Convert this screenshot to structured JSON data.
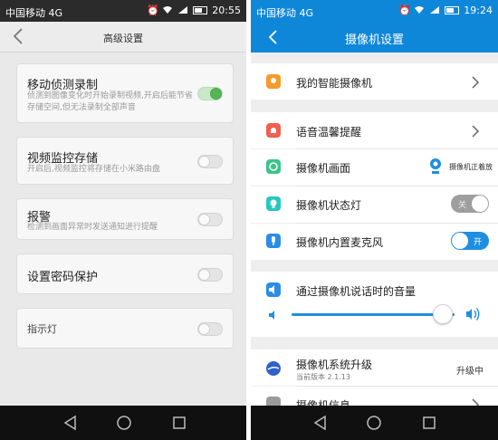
{
  "left": {
    "status": {
      "carrier": "中国移动 4G",
      "time": "20:55"
    },
    "header": {
      "title": "高级设置"
    },
    "settings": [
      {
        "title": "移动侦测录制",
        "desc": "侦测到图像变化时开始录制视频,开启后能节省存储空间,但无法录制全部声音",
        "enabled": true
      },
      {
        "title": "视频监控存储",
        "desc": "开启后,视频监控将存储在小米路由盘",
        "enabled": false
      },
      {
        "title": "报警",
        "desc": "检测到画面异常时发送通知进行提醒",
        "enabled": false
      },
      {
        "title": "设置密码保护",
        "desc": "",
        "enabled": false
      },
      {
        "title": "指示灯",
        "desc": "",
        "enabled": false
      }
    ]
  },
  "right": {
    "status": {
      "carrier": "中国移动 4G",
      "time": "19:24"
    },
    "header": {
      "title": "摄像机设置"
    },
    "rows": {
      "my_camera": {
        "label": "我的智能摄像机"
      },
      "voice_tips": {
        "label": "语音温馨提醒"
      },
      "camera_view": {
        "label": "摄像机画面",
        "status": "摄像机正着放"
      },
      "status_light": {
        "label": "摄像机状态灯",
        "toggle": "关"
      },
      "mic": {
        "label": "摄像机内置麦克风",
        "toggle": "开"
      },
      "volume": {
        "label": "通过摄像机说话时的音量",
        "level": 0.93
      },
      "upgrade": {
        "label": "摄像机系统升级",
        "sub": "当前版本 2.1.13",
        "status": "升级中"
      },
      "info": {
        "label": "摄像机信息"
      }
    }
  },
  "colors": {
    "accent_blue": "#0f87d8",
    "toggle_green": "#56b656",
    "icon_orange": "#f59a2a",
    "icon_red": "#f0604f",
    "icon_green": "#3cc48a",
    "icon_teal": "#27c7c0",
    "icon_blue": "#2b8de3",
    "icon_navy": "#2e62c9"
  }
}
